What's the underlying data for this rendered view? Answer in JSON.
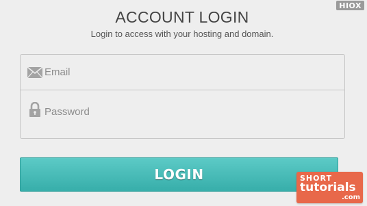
{
  "brand": {
    "label": "HIOX"
  },
  "header": {
    "title": "ACCOUNT LOGIN",
    "subtitle": "Login to access with your hosting and domain."
  },
  "form": {
    "email": {
      "placeholder": "Email",
      "value": "",
      "icon": "envelope-icon"
    },
    "password": {
      "placeholder": "Password",
      "value": "",
      "icon": "lock-icon"
    },
    "submit_label": "LOGIN"
  },
  "watermark": {
    "line1": "SHORT",
    "line2": "tutorials",
    "line3": ".com"
  },
  "colors": {
    "button": "#45bab6",
    "background": "#eeeeee",
    "watermark": "#e8684a"
  }
}
